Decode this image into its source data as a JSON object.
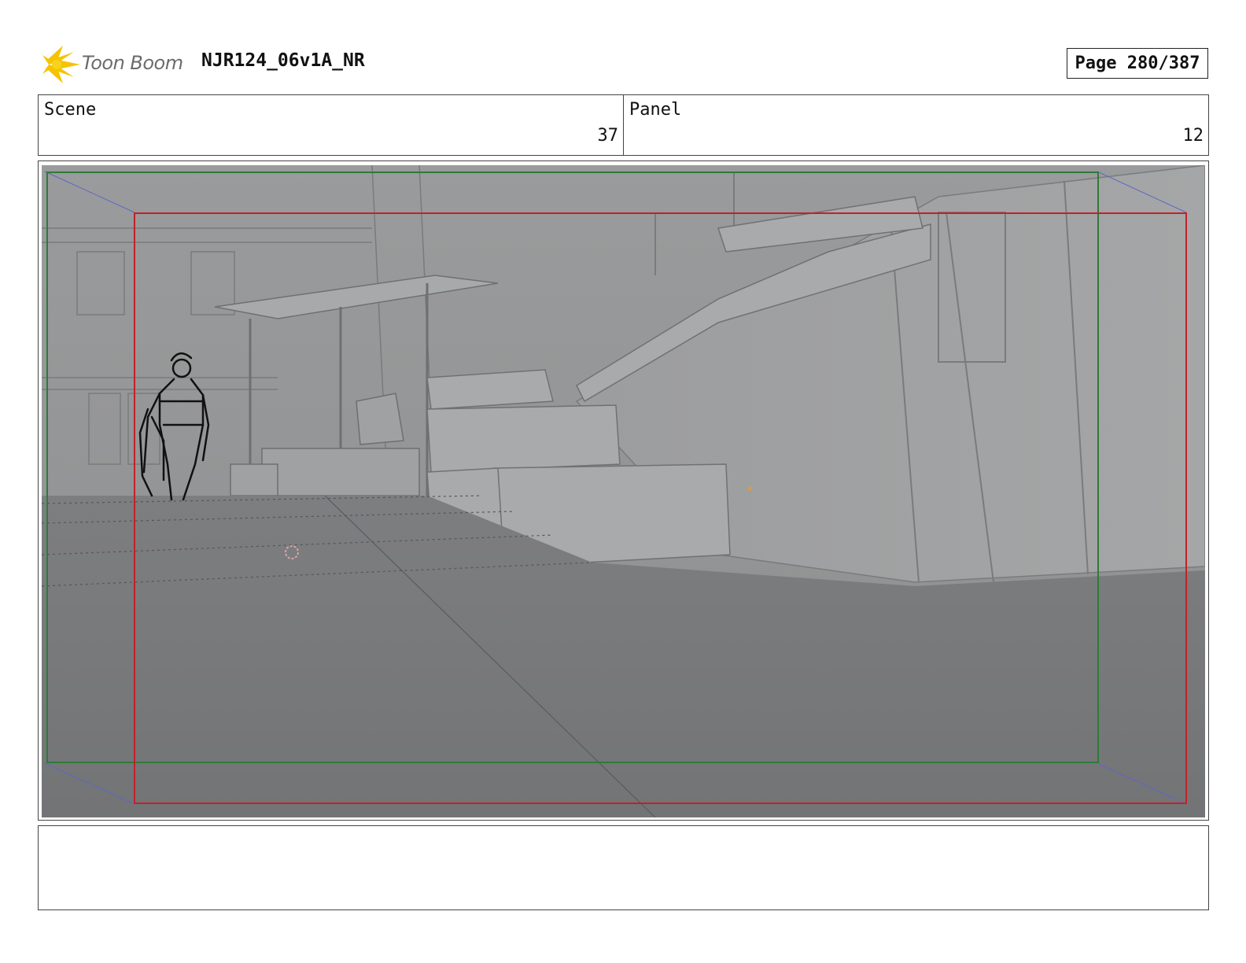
{
  "header": {
    "brand": "Toon Boom",
    "title": "NJR124_06v1A_NR",
    "page_label": "Page 280/387"
  },
  "info": {
    "scene_label": "Scene",
    "scene_value": "37",
    "panel_label": "Panel",
    "panel_value": "12"
  },
  "panel": {
    "safe_frame_color": "#2e7a3a",
    "camera_frame_color": "#c42028",
    "background_color": "#8c8d8e"
  },
  "notes": {
    "text": ""
  }
}
